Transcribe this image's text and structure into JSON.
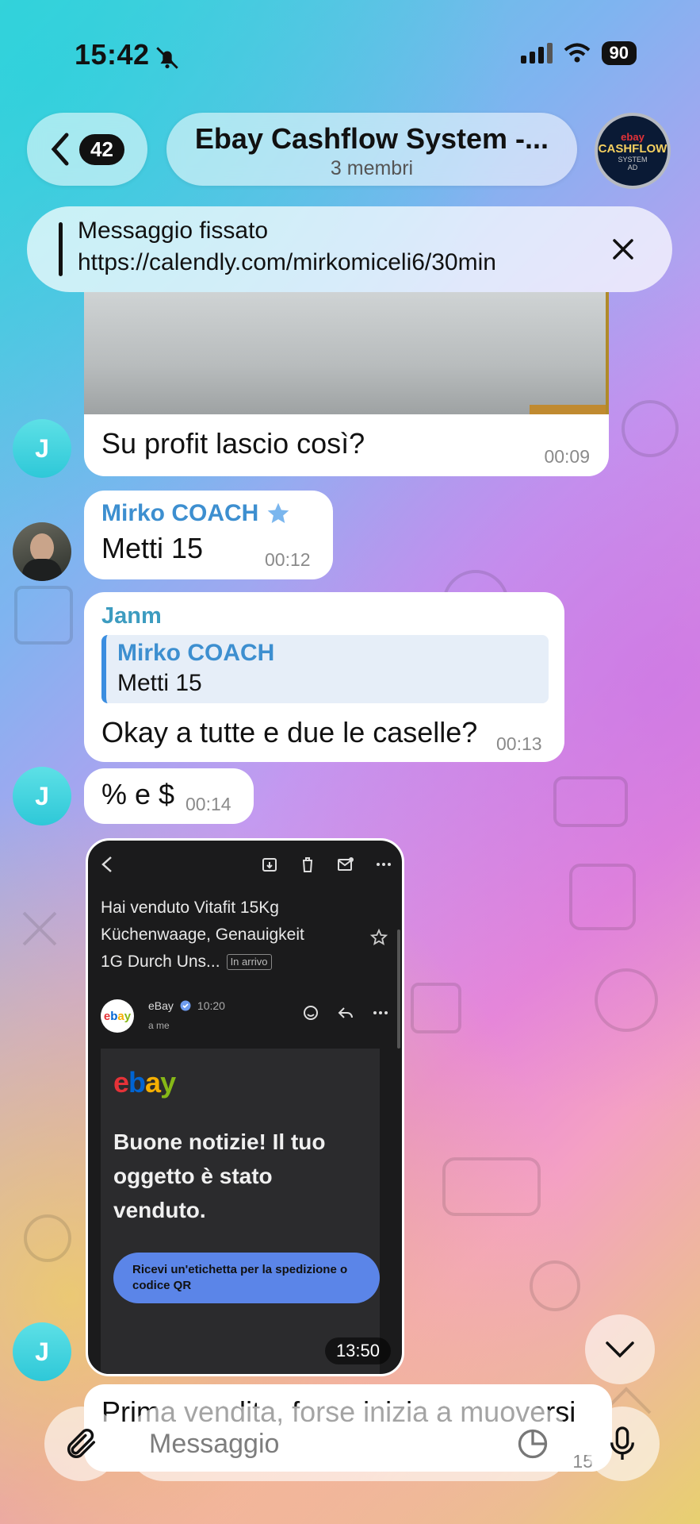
{
  "status": {
    "time": "15:42",
    "battery": "90"
  },
  "header": {
    "back_count": "42",
    "title": "Ebay Cashflow System -...",
    "subtitle": "3 membri",
    "avatar": {
      "brand": "ebay",
      "main": "CASHFLOW",
      "sub": "SYSTEM",
      "tag": "AD"
    }
  },
  "pinned": {
    "title": "Messaggio fissato",
    "text": "https://calendly.com/mirkomiceli6/30min"
  },
  "messages": [
    {
      "avatar": "J",
      "text": "Su profit lascio così?",
      "time": "00:09"
    },
    {
      "sender": "Mirko COACH",
      "text": "Metti 15",
      "time": "00:12"
    },
    {
      "sender": "Janm",
      "reply_sender": "Mirko COACH",
      "reply_text": "Metti 15",
      "text": "Okay a tutte e due le caselle?",
      "time": "00:13"
    },
    {
      "avatar": "J",
      "text": "% e $",
      "time": "00:14"
    },
    {
      "avatar": "J",
      "time": "13:50"
    },
    {
      "text": "Prima vendita, forse inizia a muoversi",
      "time": "15"
    }
  ],
  "screenshot": {
    "subject_lines": [
      "Hai venduto Vitafit 15Kg",
      "Küchenwaage, Genauigkeit",
      "1G Durch Uns..."
    ],
    "label": "In arrivo",
    "sender": "eBay",
    "sender_time": "10:20",
    "to": "a me",
    "logo": "ebay",
    "headline": [
      "Buone notizie! Il tuo",
      "oggetto è stato",
      "venduto."
    ],
    "cta": "Ricevi un'etichetta per la spedizione o codice QR"
  },
  "composer": {
    "placeholder": "Messaggio"
  },
  "colors": {
    "sender_blue": "#3d8fd0",
    "star": "#7ab6ee",
    "reply_bar": "#3a8de0"
  }
}
